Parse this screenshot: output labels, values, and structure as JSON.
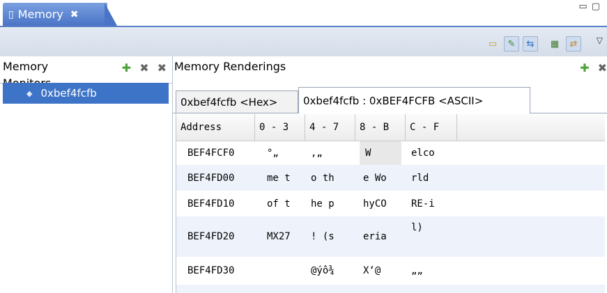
{
  "view_tab": {
    "label": "Memory",
    "close_glyph": "✖"
  },
  "monitors_pane": {
    "title": "Memory",
    "title_clipped_second_line": "Monitors",
    "items": [
      {
        "label": "0xbef4fcfb"
      }
    ]
  },
  "renderings_pane": {
    "title": "Memory Renderings",
    "tabs": [
      {
        "label": "0xbef4fcfb <Hex>",
        "active": false
      },
      {
        "label": "0xbef4fcfb : 0xBEF4FCFB <ASCII>",
        "active": true
      }
    ],
    "columns": [
      "Address",
      "0 - 3",
      "4 - 7",
      "8 - B",
      "C - F"
    ],
    "rows": [
      {
        "address": "BEF4FCF0",
        "c0": "°„",
        "c1": "‚„",
        "c2": "W",
        "c3": "elco"
      },
      {
        "address": "BEF4FD00",
        "c0": "me t",
        "c1": "o th",
        "c2": "e Wo",
        "c3": "rld"
      },
      {
        "address": "BEF4FD10",
        "c0": "of t",
        "c1": "he p",
        "c2": "hyCO",
        "c3": "RE-i"
      },
      {
        "address": "BEF4FD20",
        "c0": "MX27",
        "c1": "! (s",
        "c2": "eria",
        "c3": "l)"
      },
      {
        "address": "BEF4FD30",
        "c0": "",
        "c1": "@ýô¾",
        "c2": "X‘@",
        "c3": "„„"
      }
    ]
  },
  "colors": {
    "view_tab_bg": "#4a74c6",
    "selection": "#3e74c8",
    "toolbar_bg": "#dbe2ed",
    "alt_row": "#eef3fb"
  },
  "icons": {
    "view_tab": "memory-view-icon",
    "toolbar": [
      "new-rendering-icon",
      "toggle-split-icon",
      "link-renderings-icon",
      "table-layout-icon",
      "swap-icon",
      "view-menu-icon"
    ],
    "monitor_actions": [
      "add-monitor-icon",
      "remove-monitor-icon",
      "remove-all-monitors-icon"
    ],
    "rendering_actions": [
      "add-rendering-icon",
      "remove-rendering-icon"
    ]
  }
}
